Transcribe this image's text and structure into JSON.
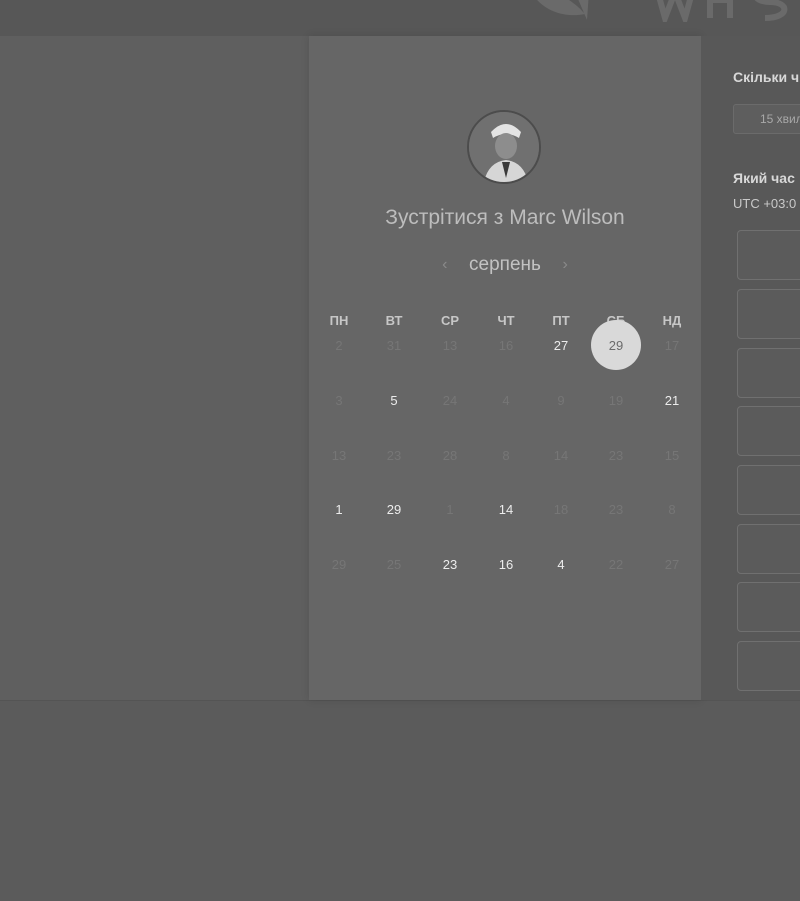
{
  "host": {
    "title_prefix": "Зустрітися з",
    "name": "Marc Wilson"
  },
  "calendar": {
    "month": "серпень",
    "prev_label": "‹",
    "next_label": "›",
    "weekdays": [
      "ПН",
      "ВТ",
      "СР",
      "ЧТ",
      "ПТ",
      "СБ",
      "НД"
    ],
    "weeks": [
      [
        {
          "d": "2",
          "s": "disabled"
        },
        {
          "d": "31",
          "s": "disabled"
        },
        {
          "d": "13",
          "s": "disabled"
        },
        {
          "d": "16",
          "s": "disabled"
        },
        {
          "d": "27",
          "s": "available"
        },
        {
          "d": "29",
          "s": "selected"
        },
        {
          "d": "17",
          "s": "disabled"
        }
      ],
      [
        {
          "d": "3",
          "s": "disabled"
        },
        {
          "d": "5",
          "s": "available"
        },
        {
          "d": "24",
          "s": "disabled"
        },
        {
          "d": "4",
          "s": "disabled"
        },
        {
          "d": "9",
          "s": "disabled"
        },
        {
          "d": "19",
          "s": "disabled"
        },
        {
          "d": "21",
          "s": "available"
        }
      ],
      [
        {
          "d": "13",
          "s": "disabled"
        },
        {
          "d": "23",
          "s": "disabled"
        },
        {
          "d": "28",
          "s": "disabled"
        },
        {
          "d": "8",
          "s": "disabled"
        },
        {
          "d": "14",
          "s": "disabled"
        },
        {
          "d": "23",
          "s": "disabled"
        },
        {
          "d": "15",
          "s": "disabled"
        }
      ],
      [
        {
          "d": "1",
          "s": "available"
        },
        {
          "d": "29",
          "s": "available"
        },
        {
          "d": "1",
          "s": "disabled"
        },
        {
          "d": "14",
          "s": "available"
        },
        {
          "d": "18",
          "s": "disabled"
        },
        {
          "d": "23",
          "s": "disabled"
        },
        {
          "d": "8",
          "s": "disabled"
        }
      ],
      [
        {
          "d": "29",
          "s": "disabled"
        },
        {
          "d": "25",
          "s": "disabled"
        },
        {
          "d": "23",
          "s": "available"
        },
        {
          "d": "16",
          "s": "available"
        },
        {
          "d": "4",
          "s": "available"
        },
        {
          "d": "22",
          "s": "disabled"
        },
        {
          "d": "27",
          "s": "disabled"
        }
      ]
    ]
  },
  "side": {
    "duration_heading": "Скільки ч",
    "duration_value": "15 хвил",
    "time_heading": "Який час",
    "timezone": "UTC +03:0"
  },
  "colors": {
    "selected_day_bg": "#d9d9d9",
    "available_day": "#ececec",
    "disabled_day": "#767676"
  }
}
